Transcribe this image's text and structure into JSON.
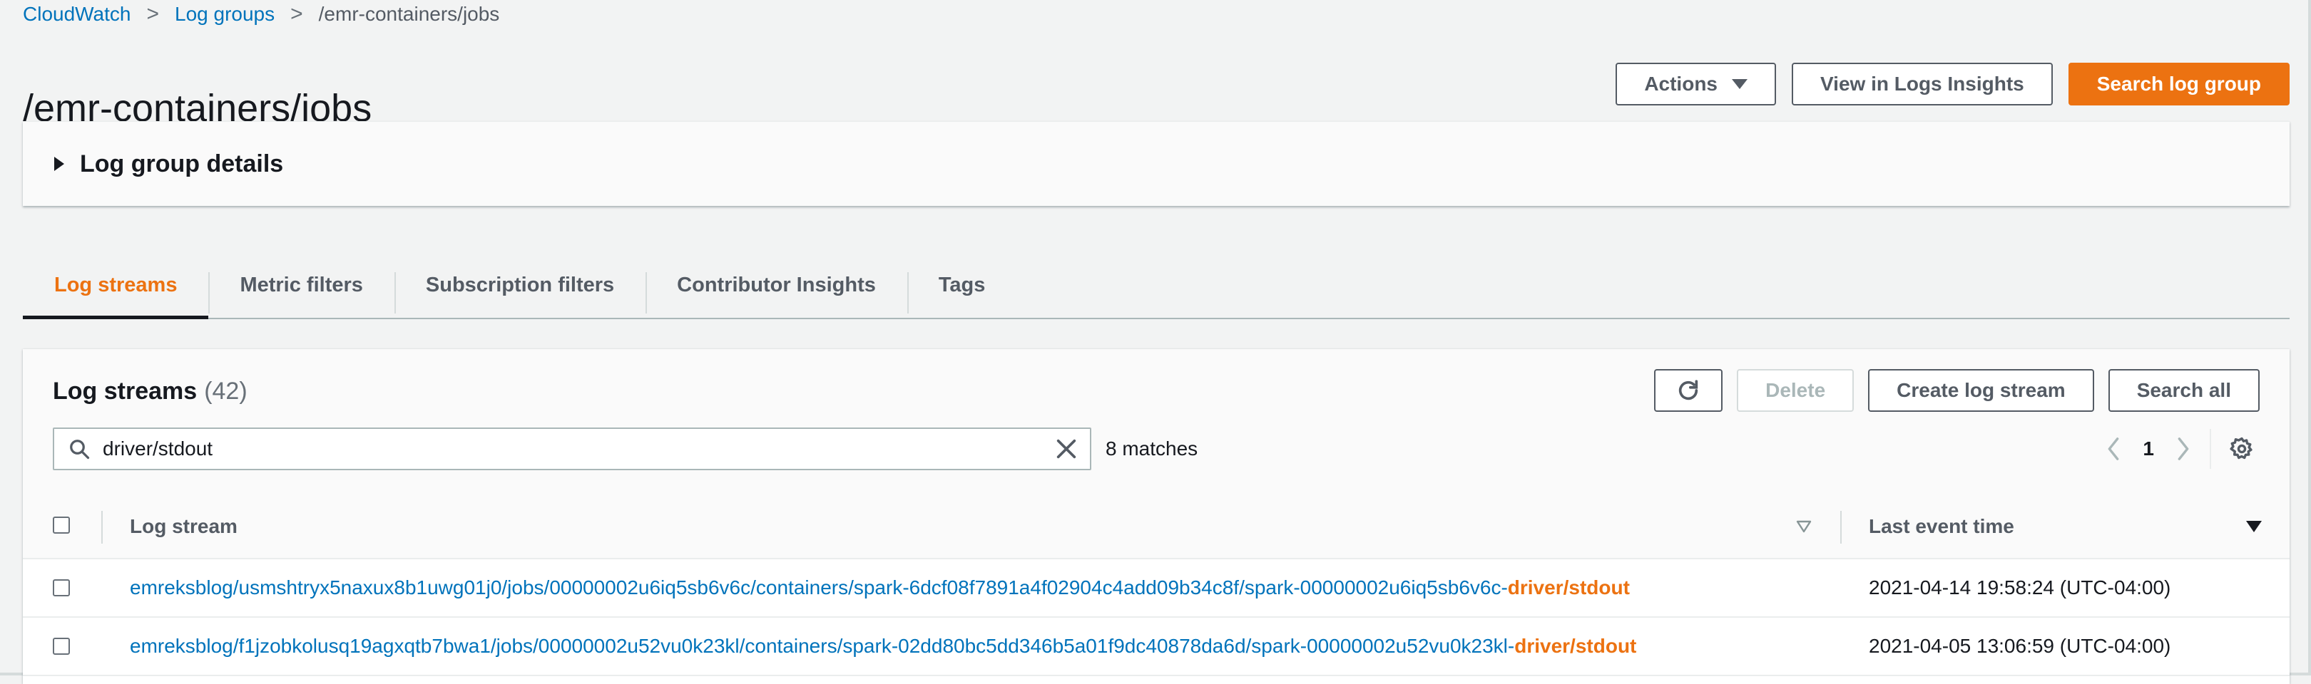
{
  "breadcrumb": {
    "items": [
      "CloudWatch",
      "Log groups"
    ],
    "current": "/emr-containers/jobs",
    "separator": ">"
  },
  "header": {
    "title": "/emr-containers/jobs",
    "actions_label": "Actions",
    "view_insights_label": "View in Logs Insights",
    "search_group_label": "Search log group"
  },
  "details": {
    "title": "Log group details",
    "expanded": false
  },
  "tabs": [
    {
      "label": "Log streams",
      "active": true
    },
    {
      "label": "Metric filters",
      "active": false
    },
    {
      "label": "Subscription filters",
      "active": false
    },
    {
      "label": "Contributor Insights",
      "active": false
    },
    {
      "label": "Tags",
      "active": false
    }
  ],
  "streams": {
    "title": "Log streams",
    "count": "(42)",
    "delete_label": "Delete",
    "create_label": "Create log stream",
    "search_all_label": "Search all",
    "search_value": "driver/stdout",
    "matches": "8 matches",
    "page": "1",
    "columns": {
      "stream": "Log stream",
      "time": "Last event time"
    },
    "rows": [
      {
        "prefix": "emreksblog/usmshtryx5naxux8b1uwg01j0/jobs/00000002u6iq5sb6v6c/containers/spark-6dcf08f7891a4f02904c4add09b34c8f/spark-00000002u6iq5sb6v6c-",
        "match": "driver/stdout",
        "time": "2021-04-14 19:58:24 (UTC-04:00)"
      },
      {
        "prefix": "emreksblog/f1jzobkolusq19agxqtb7bwa1/jobs/00000002u52vu0k23kl/containers/spark-02dd80bc5dd346b5a01f9dc40878da6d/spark-00000002u52vu0k23kl-",
        "match": "driver/stdout",
        "time": "2021-04-05 13:06:59 (UTC-04:00)"
      }
    ]
  },
  "icons": {
    "refresh": "refresh-icon",
    "search": "search-icon",
    "clear": "close-icon",
    "prev": "chevron-left-icon",
    "next": "chevron-right-icon",
    "settings": "gear-icon",
    "filter": "filter-triangle-icon",
    "sort": "sort-descending-icon"
  },
  "colors": {
    "accent": "#ec7211",
    "link": "#0073bb",
    "background": "#f2f3f3"
  }
}
